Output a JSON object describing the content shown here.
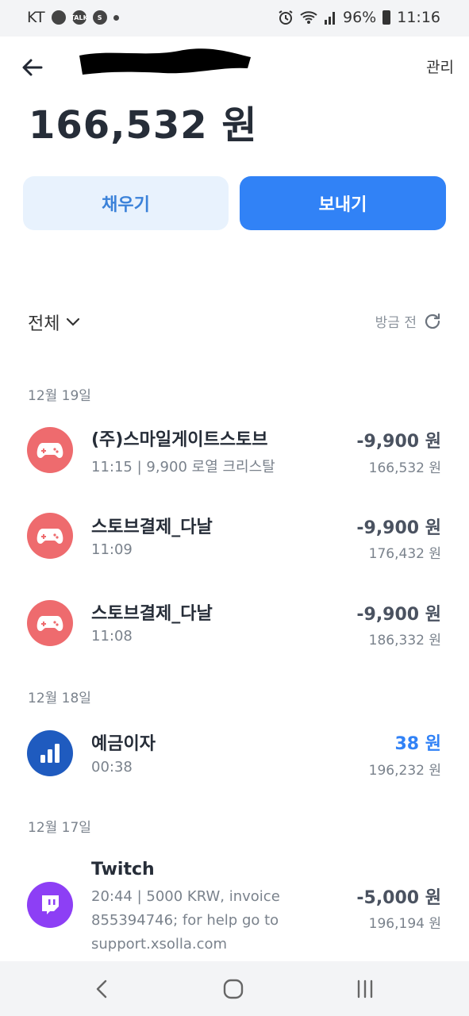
{
  "status_bar": {
    "carrier": "KT",
    "chat_badge": "TALK",
    "s_badge": "S",
    "battery": "96%",
    "time": "11:16"
  },
  "header": {
    "manage_label": "관리"
  },
  "balance": "166,532 원",
  "actions": {
    "fill_label": "채우기",
    "send_label": "보내기"
  },
  "filter": {
    "label": "전체",
    "updated": "방금 전"
  },
  "groups": [
    {
      "date": "12월 19일",
      "items": [
        {
          "title": "(주)스마일게이트스토브",
          "sub": "11:15 | 9,900 로열 크리스탈",
          "amount": "-9,900 원",
          "balance": "166,532 원",
          "icon": "gamepad-icon"
        },
        {
          "title": "스토브결제_다날",
          "sub": "11:09",
          "amount": "-9,900 원",
          "balance": "176,432 원",
          "icon": "gamepad-icon"
        },
        {
          "title": "스토브결제_다날",
          "sub": "11:08",
          "amount": "-9,900 원",
          "balance": "186,332 원",
          "icon": "gamepad-icon"
        }
      ]
    },
    {
      "date": "12월 18일",
      "items": [
        {
          "title": "예금이자",
          "sub": "00:38",
          "amount": "38 원",
          "balance": "196,232 원",
          "icon": "bar-chart-icon"
        }
      ]
    },
    {
      "date": "12월 17일",
      "items": [
        {
          "title": "Twitch",
          "sub_lines": [
            "20:44 | 5000 KRW, invoice",
            "855394746; for help go to",
            "support.xsolla.com"
          ],
          "amount": "-5,000 원",
          "balance": "196,194 원",
          "icon": "twitch-icon"
        }
      ]
    }
  ],
  "colors": {
    "accent": "#3182f6",
    "fill_button_bg": "#e8f2fd",
    "game_icon_bg": "#ee6b6e",
    "interest_icon_bg": "#1f5bbf",
    "twitch_icon_bg": "#8d3ff5"
  }
}
